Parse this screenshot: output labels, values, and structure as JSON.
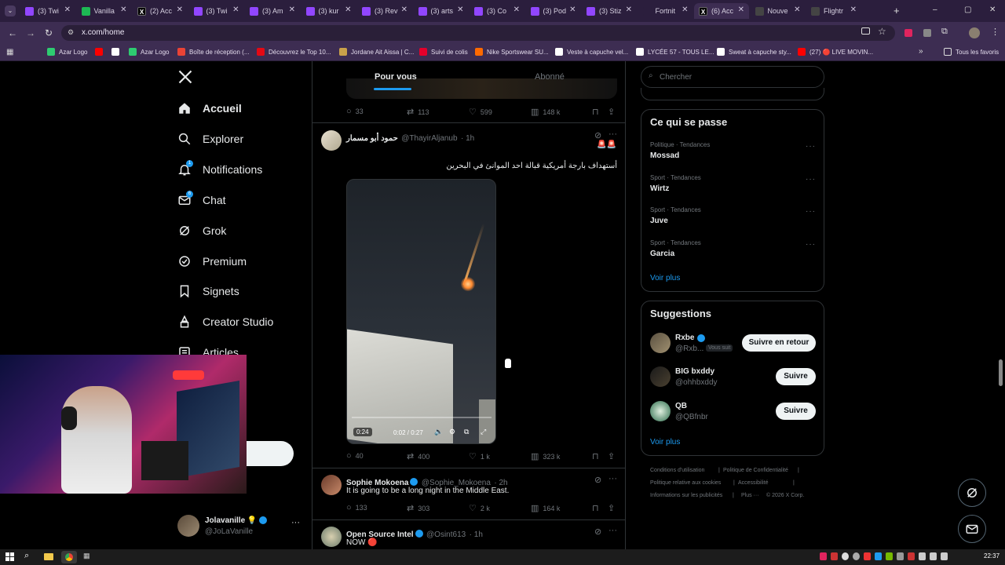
{
  "browser": {
    "tabs": [
      {
        "label": "(3) Twi",
        "color": "#9146ff",
        "letter": ""
      },
      {
        "label": "Vanilla",
        "color": "#1db954",
        "letter": ""
      },
      {
        "label": "(2) Acc",
        "color": "#000000",
        "letter": "X"
      },
      {
        "label": "(3) Twi",
        "color": "#9146ff",
        "letter": ""
      },
      {
        "label": "(3) Am",
        "color": "#9146ff",
        "letter": ""
      },
      {
        "label": "(3) kur",
        "color": "#9146ff",
        "letter": ""
      },
      {
        "label": "(3) Rev",
        "color": "#9146ff",
        "letter": ""
      },
      {
        "label": "(3) arts",
        "color": "#9146ff",
        "letter": ""
      },
      {
        "label": "(3) Co",
        "color": "#9146ff",
        "letter": ""
      },
      {
        "label": "(3) Pod",
        "color": "#9146ff",
        "letter": ""
      },
      {
        "label": "(3) Stiz",
        "color": "#9146ff",
        "letter": ""
      },
      {
        "label": "Fortnit",
        "color": "#2b1e3d",
        "letter": ""
      },
      {
        "label": "(6) Acc",
        "color": "#000000",
        "letter": "X"
      },
      {
        "label": "Nouve",
        "color": "#444444",
        "letter": ""
      },
      {
        "label": "Flightr",
        "color": "#444444",
        "letter": ""
      }
    ],
    "new_tab": "+",
    "window_controls": [
      "–",
      "▢",
      "✕"
    ],
    "url": "x.com/home",
    "bookmarks": [
      {
        "label": "Azar Logo",
        "color": "#2ecc71"
      },
      {
        "label": "",
        "color": "#ff0000"
      },
      {
        "label": "",
        "color": "#ffffff"
      },
      {
        "label": "Azar Logo",
        "color": "#2ecc71"
      },
      {
        "label": "Boîte de réception (...",
        "color": "#ea4335"
      },
      {
        "label": "Découvrez le Top 10...",
        "color": "#e50914"
      },
      {
        "label": "Jordane Ait Aissa | C...",
        "color": "#c9a14a"
      },
      {
        "label": "Suivi de colis",
        "color": "#e4002b"
      },
      {
        "label": "Nike Sportswear SU...",
        "color": "#ff6a00"
      },
      {
        "label": "Veste à capuche vel...",
        "color": "#ffffff"
      },
      {
        "label": "LYCÉE 57 - TOUS LE...",
        "color": "#ffffff"
      },
      {
        "label": "Sweat à capuche sty...",
        "color": "#ffffff"
      },
      {
        "label": "(27) 🔴 LIVE MOVIN...",
        "color": "#ff0000"
      }
    ],
    "bookmarks_more": "»",
    "all_bookmarks": "Tous les favoris"
  },
  "nav": {
    "logo": "X",
    "items": [
      {
        "label": "Accueil",
        "icon": "home-icon",
        "bold": true,
        "badge": ""
      },
      {
        "label": "Explorer",
        "icon": "search-icon",
        "bold": false,
        "badge": ""
      },
      {
        "label": "Notifications",
        "icon": "bell-icon",
        "bold": false,
        "badge": "1"
      },
      {
        "label": "Chat",
        "icon": "mail-icon",
        "bold": false,
        "badge": "6"
      },
      {
        "label": "Grok",
        "icon": "grok-icon",
        "bold": false,
        "badge": ""
      },
      {
        "label": "Premium",
        "icon": "premium-icon",
        "bold": false,
        "badge": ""
      },
      {
        "label": "Signets",
        "icon": "bookmark-icon",
        "bold": false,
        "badge": ""
      },
      {
        "label": "Creator Studio",
        "icon": "creator-icon",
        "bold": false,
        "badge": ""
      },
      {
        "label": "Articles",
        "icon": "articles-icon",
        "bold": false,
        "badge": ""
      }
    ],
    "account": {
      "name": "Jolavanille 💡",
      "handle": "@JoLaVanille",
      "more": "···"
    }
  },
  "timeline": {
    "tabs": [
      {
        "label": "Pour vous",
        "active": true
      },
      {
        "label": "Abonné",
        "active": false
      }
    ],
    "prev_metrics": {
      "replies": "33",
      "reposts": "113",
      "likes": "599",
      "views": "148 k"
    },
    "tweets": [
      {
        "name": "حمود أبو مسمار",
        "handle": "@ThayirAljanub",
        "time": "· 1h",
        "text": "أستهداف بارجة أمريكية قبالة احد الموانئ في البحرين",
        "flags": "🚨🚨",
        "video": {
          "elapsed": "0:24",
          "time": "0:02 / 0:27"
        },
        "metrics": {
          "replies": "40",
          "reposts": "400",
          "likes": "1 k",
          "views": "323 k"
        }
      },
      {
        "name": "Sophie Mokoena",
        "handle": "@Sophie_Mokoena",
        "time": "· 2h",
        "text": "It is going to be a long night in the Middle East.",
        "metrics": {
          "replies": "133",
          "reposts": "303",
          "likes": "2 k",
          "views": "164 k"
        }
      },
      {
        "name": "Open Source Intel",
        "handle": "@Osint613",
        "time": "· 1h",
        "text": "NOW 🔴"
      }
    ]
  },
  "right": {
    "search_placeholder": "Chercher",
    "trends_title": "Ce qui se passe",
    "trends": [
      {
        "category": "Politique · Tendances",
        "name": "Mossad"
      },
      {
        "category": "Sport · Tendances",
        "name": "Wirtz"
      },
      {
        "category": "Sport · Tendances",
        "name": "Juve"
      },
      {
        "category": "Sport · Tendances",
        "name": "Garcia"
      }
    ],
    "trends_more": "Voir plus",
    "suggestions_title": "Suggestions",
    "suggestions": [
      {
        "name": "Rxbe",
        "handle": "@Rxb...",
        "follows_you": "Vous suit",
        "button": "Suivre en retour",
        "verified": true
      },
      {
        "name": "BIG bxddy",
        "handle": "@ohhbxddy",
        "follows_you": "",
        "button": "Suivre",
        "verified": false
      },
      {
        "name": "QB",
        "handle": "@QBfnbr",
        "follows_you": "",
        "button": "Suivre",
        "verified": false
      }
    ],
    "suggestions_more": "Voir plus",
    "footer": [
      "Conditions d'utilisation",
      "|",
      "Politique de Confidentialité",
      "|",
      "Politique relative aux cookies",
      "|",
      "Accessibilité",
      "|",
      "Informations sur les publicités",
      "|",
      "Plus ···",
      "© 2026 X Corp."
    ]
  },
  "taskbar": {
    "clock": "22:37"
  },
  "colors": {
    "accent": "#1d9bf0",
    "browser_frame": "#3d2d52",
    "tab_strip": "#2b1e3d"
  }
}
